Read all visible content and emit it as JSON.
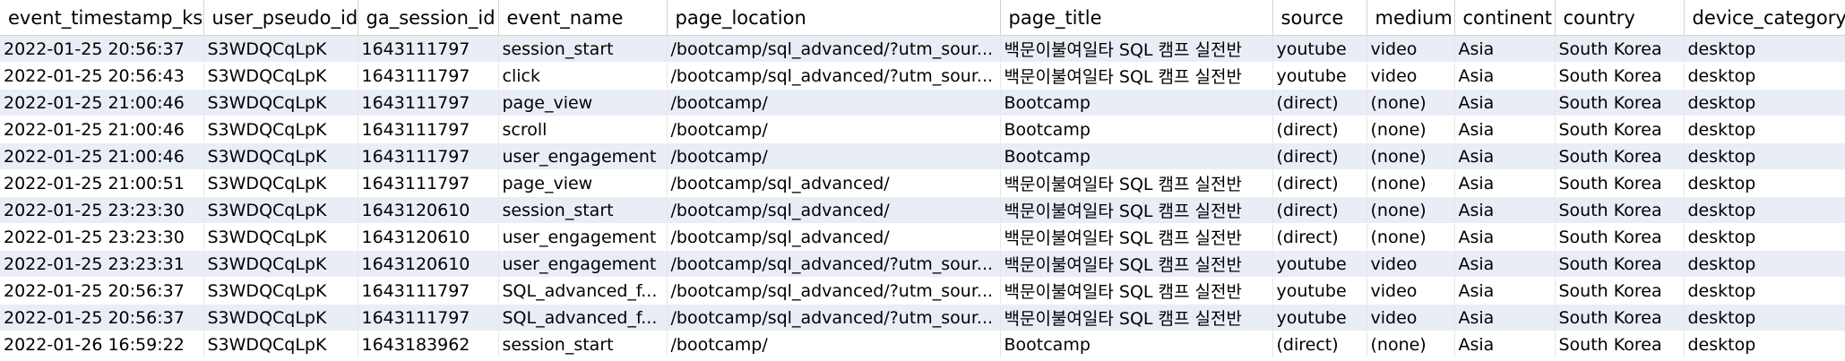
{
  "columns": [
    "event_timestamp_kst",
    "user_pseudo_id",
    "ga_session_id",
    "event_name",
    "page_location",
    "page_title",
    "source",
    "medium",
    "continent",
    "country",
    "device_category"
  ],
  "rows": [
    [
      "2022-01-25 20:56:37",
      "S3WDQCqLpK",
      "1643111797",
      "session_start",
      "/bootcamp/sql_advanced/?utm_sour...",
      "백문이불여일타 SQL 캠프 실전반",
      "youtube",
      "video",
      "Asia",
      "South Korea",
      "desktop"
    ],
    [
      "2022-01-25 20:56:43",
      "S3WDQCqLpK",
      "1643111797",
      "click",
      "/bootcamp/sql_advanced/?utm_sour...",
      "백문이불여일타 SQL 캠프 실전반",
      "youtube",
      "video",
      "Asia",
      "South Korea",
      "desktop"
    ],
    [
      "2022-01-25 21:00:46",
      "S3WDQCqLpK",
      "1643111797",
      "page_view",
      "/bootcamp/",
      "Bootcamp",
      "(direct)",
      "(none)",
      "Asia",
      "South Korea",
      "desktop"
    ],
    [
      "2022-01-25 21:00:46",
      "S3WDQCqLpK",
      "1643111797",
      "scroll",
      "/bootcamp/",
      "Bootcamp",
      "(direct)",
      "(none)",
      "Asia",
      "South Korea",
      "desktop"
    ],
    [
      "2022-01-25 21:00:46",
      "S3WDQCqLpK",
      "1643111797",
      "user_engagement",
      "/bootcamp/",
      "Bootcamp",
      "(direct)",
      "(none)",
      "Asia",
      "South Korea",
      "desktop"
    ],
    [
      "2022-01-25 21:00:51",
      "S3WDQCqLpK",
      "1643111797",
      "page_view",
      "/bootcamp/sql_advanced/",
      "백문이불여일타 SQL 캠프 실전반",
      "(direct)",
      "(none)",
      "Asia",
      "South Korea",
      "desktop"
    ],
    [
      "2022-01-25 23:23:30",
      "S3WDQCqLpK",
      "1643120610",
      "session_start",
      "/bootcamp/sql_advanced/",
      "백문이불여일타 SQL 캠프 실전반",
      "(direct)",
      "(none)",
      "Asia",
      "South Korea",
      "desktop"
    ],
    [
      "2022-01-25 23:23:30",
      "S3WDQCqLpK",
      "1643120610",
      "user_engagement",
      "/bootcamp/sql_advanced/",
      "백문이불여일타 SQL 캠프 실전반",
      "(direct)",
      "(none)",
      "Asia",
      "South Korea",
      "desktop"
    ],
    [
      "2022-01-25 23:23:31",
      "S3WDQCqLpK",
      "1643120610",
      "user_engagement",
      "/bootcamp/sql_advanced/?utm_sour...",
      "백문이불여일타 SQL 캠프 실전반",
      "youtube",
      "video",
      "Asia",
      "South Korea",
      "desktop"
    ],
    [
      "2022-01-25 20:56:37",
      "S3WDQCqLpK",
      "1643111797",
      "SQL_advanced_f...",
      "/bootcamp/sql_advanced/?utm_sour...",
      "백문이불여일타 SQL 캠프 실전반",
      "youtube",
      "video",
      "Asia",
      "South Korea",
      "desktop"
    ],
    [
      "2022-01-25 20:56:37",
      "S3WDQCqLpK",
      "1643111797",
      "SQL_advanced_f...",
      "/bootcamp/sql_advanced/?utm_sour...",
      "백문이불여일타 SQL 캠프 실전반",
      "youtube",
      "video",
      "Asia",
      "South Korea",
      "desktop"
    ],
    [
      "2022-01-26 16:59:22",
      "S3WDQCqLpK",
      "1643183962",
      "session_start",
      "/bootcamp/",
      "Bootcamp",
      "(direct)",
      "(none)",
      "Asia",
      "South Korea",
      "desktop"
    ]
  ],
  "colors": {
    "row_alt": "#e9edf6",
    "row_plain": "#ffffff",
    "header_bg": "#ffffff",
    "border": "#d4d4d4"
  }
}
